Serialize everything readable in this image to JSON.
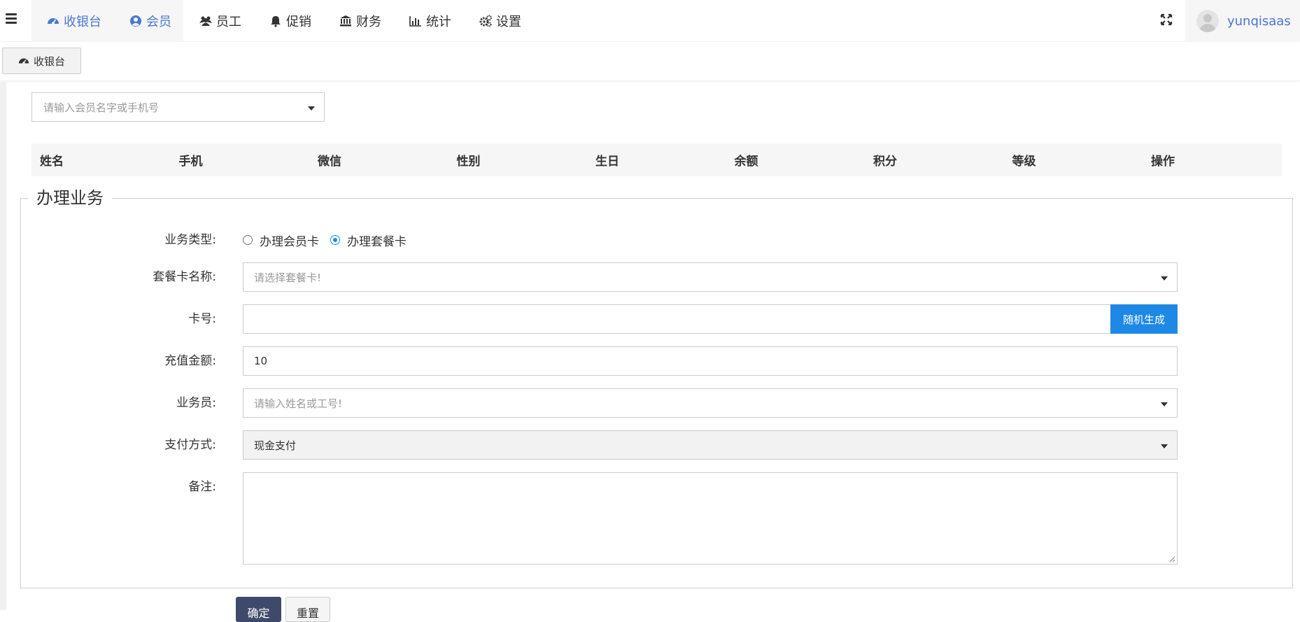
{
  "header": {
    "nav": [
      {
        "label": "收银台",
        "icon": "dashboard-icon"
      },
      {
        "label": "会员",
        "icon": "user-circle-icon"
      },
      {
        "label": "员工",
        "icon": "users-icon"
      },
      {
        "label": "促销",
        "icon": "bell-icon"
      },
      {
        "label": "财务",
        "icon": "bank-icon"
      },
      {
        "label": "统计",
        "icon": "bar-chart-icon"
      },
      {
        "label": "设置",
        "icon": "gears-icon"
      }
    ],
    "username": "yunqisaas"
  },
  "tabs": [
    {
      "label": "收银台",
      "icon": "dashboard-icon"
    }
  ],
  "member_search": {
    "placeholder": "请输入会员名字或手机号"
  },
  "table": {
    "headers": [
      "姓名",
      "手机",
      "微信",
      "性别",
      "生日",
      "余额",
      "积分",
      "等级",
      "操作"
    ]
  },
  "form": {
    "legend": "办理业务",
    "business_type_label": "业务类型:",
    "business_type_options": [
      "办理会员卡",
      "办理套餐卡"
    ],
    "business_type_selected": "办理套餐卡",
    "package_label": "套餐卡名称:",
    "package_placeholder": "请选择套餐卡!",
    "card_no_label": "卡号:",
    "card_no_value": "",
    "generate_label": "随机生成",
    "amount_label": "充值金额:",
    "amount_value": "10",
    "staff_label": "业务员:",
    "staff_placeholder": "请输入姓名或工号!",
    "payment_label": "支付方式:",
    "payment_value": "现金支付",
    "remark_label": "备注:",
    "confirm_label": "确定",
    "reset_label": "重置"
  },
  "colors": {
    "accent": "#1e88e5",
    "nav_active": "#4a76d4",
    "confirm_bg": "#3f4a6a"
  }
}
